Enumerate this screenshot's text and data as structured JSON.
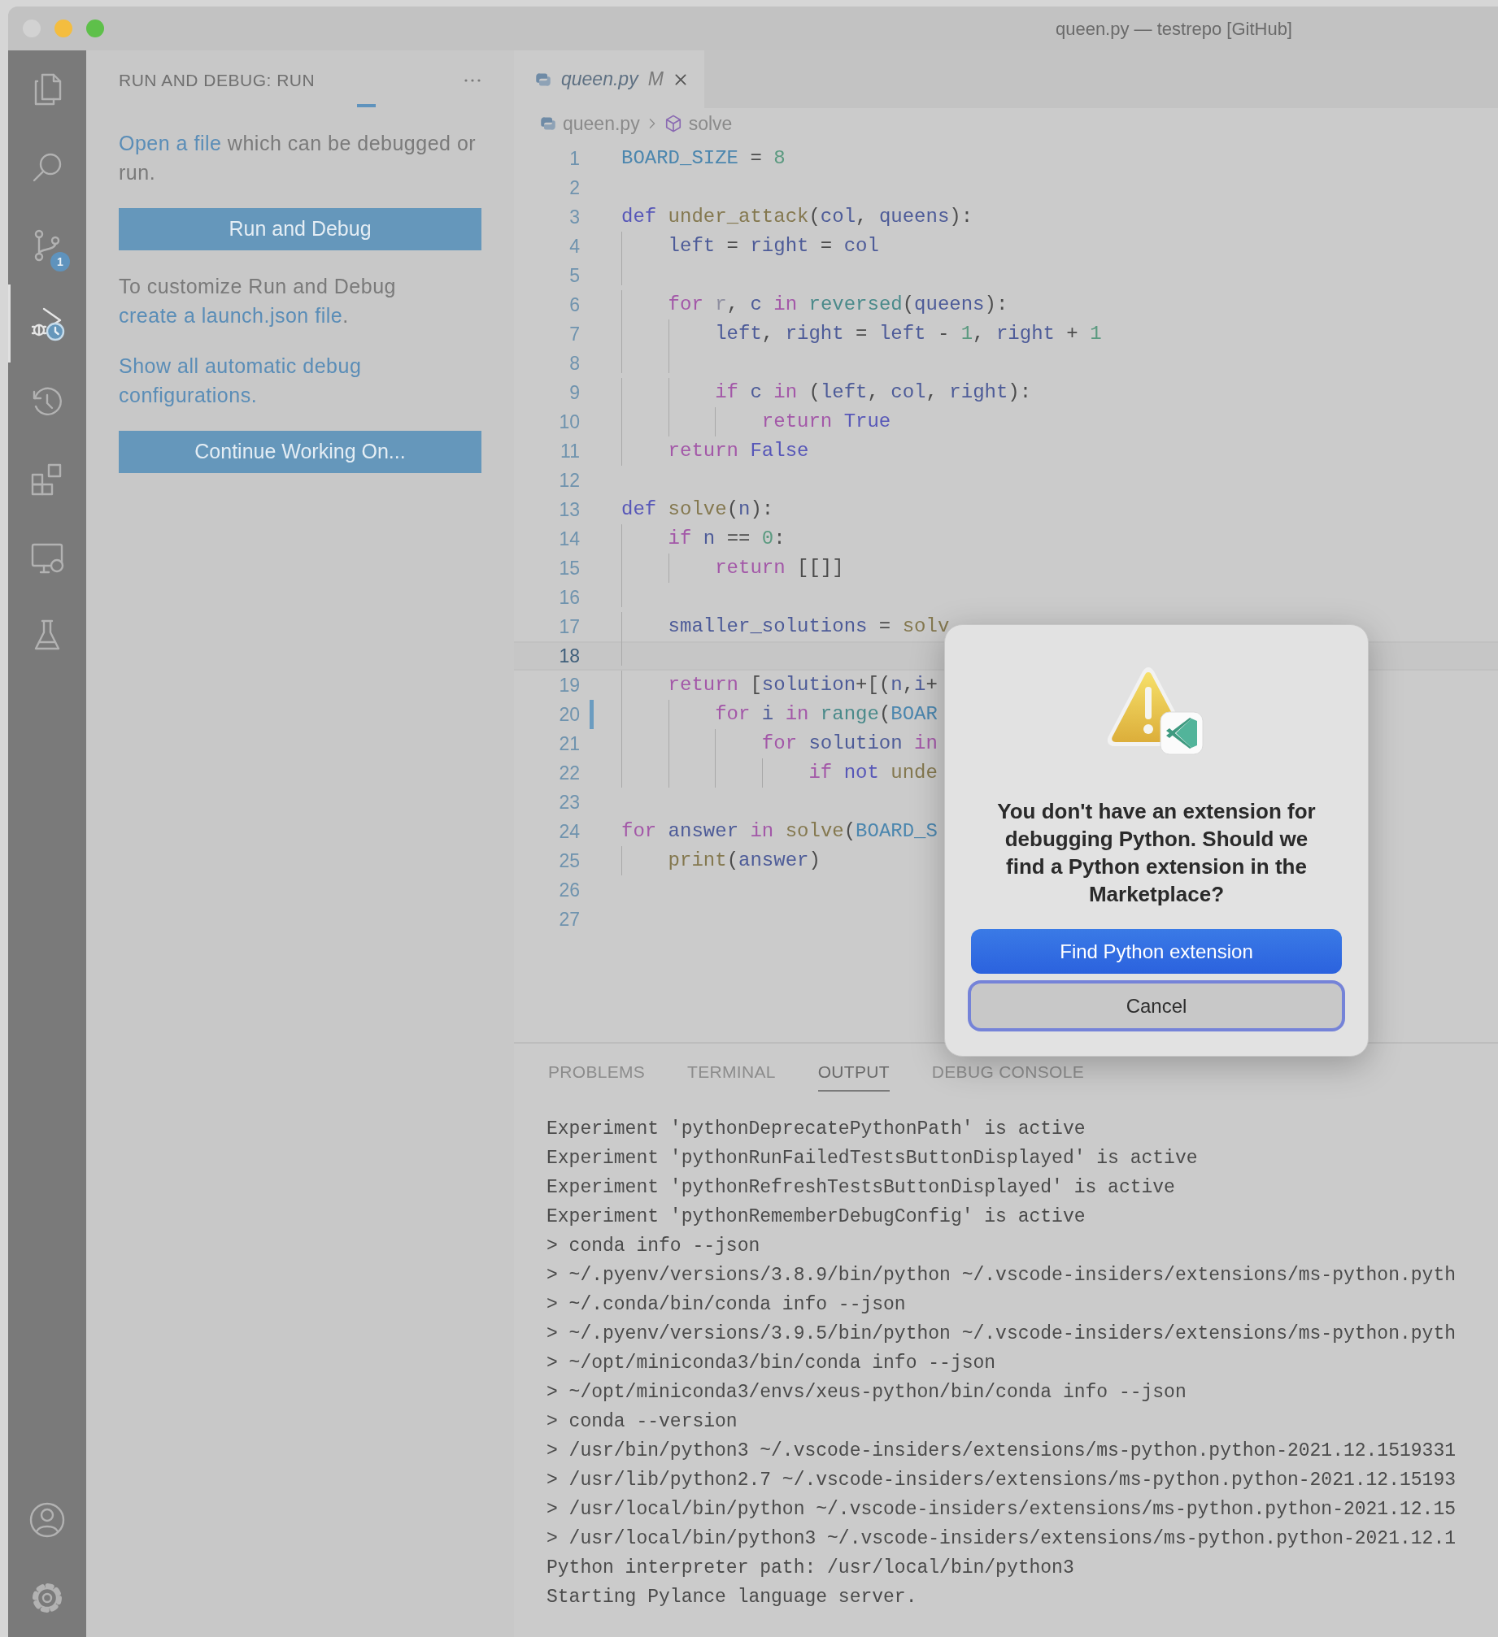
{
  "window": {
    "title": "queen.py — testrepo [GitHub]"
  },
  "activity_bar": {
    "items": [
      {
        "kind": "explorer",
        "selected": false
      },
      {
        "kind": "search",
        "selected": false
      },
      {
        "kind": "source-control",
        "selected": false,
        "badge": "1"
      },
      {
        "kind": "run-debug",
        "selected": true
      },
      {
        "kind": "timeline",
        "selected": false
      },
      {
        "kind": "extensions",
        "selected": false
      },
      {
        "kind": "remote",
        "selected": false
      },
      {
        "kind": "testing",
        "selected": false
      }
    ],
    "bottom_items": [
      {
        "kind": "account"
      },
      {
        "kind": "settings"
      }
    ]
  },
  "sidebar": {
    "title": "RUN AND DEBUG: RUN",
    "busy": true,
    "content": [
      {
        "kind": "paragraph",
        "parts": [
          {
            "text": "Open a file",
            "link": true
          },
          {
            "text": " which can be debugged or run.",
            "link": false
          }
        ]
      },
      {
        "kind": "button",
        "label": "Run and Debug"
      },
      {
        "kind": "paragraph",
        "parts": [
          {
            "text": "To customize Run and Debug ",
            "link": false
          },
          {
            "text": "create a launch.json file",
            "link": true
          },
          {
            "text": ".",
            "link": false
          }
        ]
      },
      {
        "kind": "paragraph",
        "parts": [
          {
            "text": "Show all automatic debug configurations.",
            "link": true
          }
        ]
      },
      {
        "kind": "button",
        "label": "Continue Working On..."
      }
    ]
  },
  "editor": {
    "tabs": [
      {
        "label": "queen.py",
        "badge": "M",
        "selected": true,
        "preview": true
      }
    ],
    "breadcrumb": [
      {
        "kind": "file",
        "text": "queen.py"
      },
      {
        "kind": "symbol",
        "text": "solve"
      }
    ],
    "lines": [
      {
        "number": "1",
        "current": false,
        "changed": false,
        "tokens": [
          {
            "kind": "const",
            "text": "BOARD_SIZE"
          },
          {
            "kind": "plain",
            "text": " = "
          },
          {
            "kind": "num",
            "text": "8"
          }
        ]
      },
      {
        "number": "2",
        "current": false,
        "changed": false
      },
      {
        "number": "3",
        "current": false,
        "changed": false,
        "tokens": [
          {
            "kind": "def",
            "text": "def"
          },
          {
            "kind": "fn",
            "text": " under_attack"
          },
          {
            "kind": "plain",
            "text": "("
          },
          {
            "kind": "var",
            "text": "col"
          },
          {
            "kind": "plain",
            "text": ", "
          },
          {
            "kind": "var",
            "text": "queens"
          },
          {
            "kind": "plain",
            "text": "):"
          }
        ]
      },
      {
        "number": "4",
        "current": false,
        "changed": false,
        "tokens": [
          {
            "kind": "var",
            "text": "    left"
          },
          {
            "kind": "plain",
            "text": " = "
          },
          {
            "kind": "var",
            "text": "right"
          },
          {
            "kind": "plain",
            "text": " = "
          },
          {
            "kind": "var",
            "text": "col"
          }
        ]
      },
      {
        "number": "5",
        "current": false,
        "changed": false
      },
      {
        "number": "6",
        "current": false,
        "changed": false,
        "tokens": [
          {
            "kind": "kw",
            "text": "    for"
          },
          {
            "kind": "unused",
            "text": " r"
          },
          {
            "kind": "plain",
            "text": ", "
          },
          {
            "kind": "var",
            "text": "c"
          },
          {
            "kind": "kw",
            "text": " in"
          },
          {
            "kind": "builtin",
            "text": " reversed"
          },
          {
            "kind": "plain",
            "text": "("
          },
          {
            "kind": "var",
            "text": "queens"
          },
          {
            "kind": "plain",
            "text": "):"
          }
        ]
      },
      {
        "number": "7",
        "current": false,
        "changed": false,
        "tokens": [
          {
            "kind": "var",
            "text": "        left"
          },
          {
            "kind": "plain",
            "text": ", "
          },
          {
            "kind": "var",
            "text": "right"
          },
          {
            "kind": "plain",
            "text": " = "
          },
          {
            "kind": "var",
            "text": "left"
          },
          {
            "kind": "plain",
            "text": " - "
          },
          {
            "kind": "num",
            "text": "1"
          },
          {
            "kind": "plain",
            "text": ", "
          },
          {
            "kind": "var",
            "text": "right"
          },
          {
            "kind": "plain",
            "text": " + "
          },
          {
            "kind": "num",
            "text": "1"
          }
        ]
      },
      {
        "number": "8",
        "current": false,
        "changed": false
      },
      {
        "number": "9",
        "current": false,
        "changed": false,
        "tokens": [
          {
            "kind": "kw",
            "text": "        if"
          },
          {
            "kind": "var",
            "text": " c"
          },
          {
            "kind": "kw",
            "text": " in"
          },
          {
            "kind": "plain",
            "text": " ("
          },
          {
            "kind": "var",
            "text": "left"
          },
          {
            "kind": "plain",
            "text": ", "
          },
          {
            "kind": "var",
            "text": "col"
          },
          {
            "kind": "plain",
            "text": ", "
          },
          {
            "kind": "var",
            "text": "right"
          },
          {
            "kind": "plain",
            "text": "):"
          }
        ]
      },
      {
        "number": "10",
        "current": false,
        "changed": false,
        "tokens": [
          {
            "kind": "kw",
            "text": "            return"
          },
          {
            "kind": "def",
            "text": " True"
          }
        ]
      },
      {
        "number": "11",
        "current": false,
        "changed": false,
        "tokens": [
          {
            "kind": "kw",
            "text": "    return"
          },
          {
            "kind": "def",
            "text": " False"
          }
        ]
      },
      {
        "number": "12",
        "current": false,
        "changed": false
      },
      {
        "number": "13",
        "current": false,
        "changed": false,
        "tokens": [
          {
            "kind": "def",
            "text": "def"
          },
          {
            "kind": "fn",
            "text": " solve"
          },
          {
            "kind": "plain",
            "text": "("
          },
          {
            "kind": "var",
            "text": "n"
          },
          {
            "kind": "plain",
            "text": "):"
          }
        ]
      },
      {
        "number": "14",
        "current": false,
        "changed": false,
        "tokens": [
          {
            "kind": "kw",
            "text": "    if"
          },
          {
            "kind": "var",
            "text": " n"
          },
          {
            "kind": "plain",
            "text": " == "
          },
          {
            "kind": "num",
            "text": "0"
          },
          {
            "kind": "plain",
            "text": ":"
          }
        ]
      },
      {
        "number": "15",
        "current": false,
        "changed": false,
        "tokens": [
          {
            "kind": "kw",
            "text": "        return"
          },
          {
            "kind": "plain",
            "text": " [[]]"
          }
        ]
      },
      {
        "number": "16",
        "current": false,
        "changed": false
      },
      {
        "number": "17",
        "current": false,
        "changed": false,
        "tokens": [
          {
            "kind": "var",
            "text": "    smaller_solutions"
          },
          {
            "kind": "plain",
            "text": " = "
          },
          {
            "kind": "fn",
            "text": "solv"
          }
        ]
      },
      {
        "number": "18",
        "current": true,
        "changed": false
      },
      {
        "number": "19",
        "current": false,
        "changed": false,
        "tokens": [
          {
            "kind": "kw",
            "text": "    return"
          },
          {
            "kind": "plain",
            "text": " ["
          },
          {
            "kind": "var",
            "text": "solution"
          },
          {
            "kind": "plain",
            "text": "+[("
          },
          {
            "kind": "var",
            "text": "n"
          },
          {
            "kind": "plain",
            "text": ","
          },
          {
            "kind": "var",
            "text": "i"
          },
          {
            "kind": "plain",
            "text": "+"
          }
        ]
      },
      {
        "number": "20",
        "current": false,
        "changed": true,
        "tokens": [
          {
            "kind": "kw",
            "text": "        for"
          },
          {
            "kind": "var",
            "text": " i"
          },
          {
            "kind": "kw",
            "text": " in"
          },
          {
            "kind": "builtin",
            "text": " range"
          },
          {
            "kind": "plain",
            "text": "("
          },
          {
            "kind": "const",
            "text": "BOAR"
          }
        ]
      },
      {
        "number": "21",
        "current": false,
        "changed": false,
        "tokens": [
          {
            "kind": "kw",
            "text": "            for"
          },
          {
            "kind": "var",
            "text": " solution"
          },
          {
            "kind": "kw",
            "text": " in"
          }
        ]
      },
      {
        "number": "22",
        "current": false,
        "changed": false,
        "tokens": [
          {
            "kind": "kw",
            "text": "                if"
          },
          {
            "kind": "def",
            "text": " not"
          },
          {
            "kind": "fn",
            "text": " unde"
          }
        ]
      },
      {
        "number": "23",
        "current": false,
        "changed": false
      },
      {
        "number": "24",
        "current": false,
        "changed": false,
        "tokens": [
          {
            "kind": "kw",
            "text": "for"
          },
          {
            "kind": "var",
            "text": " answer"
          },
          {
            "kind": "kw",
            "text": " in"
          },
          {
            "kind": "fn",
            "text": " solve"
          },
          {
            "kind": "plain",
            "text": "("
          },
          {
            "kind": "const",
            "text": "BOARD_S"
          }
        ]
      },
      {
        "number": "25",
        "current": false,
        "changed": false,
        "tokens": [
          {
            "kind": "fn",
            "text": "    print"
          },
          {
            "kind": "plain",
            "text": "("
          },
          {
            "kind": "var",
            "text": "answer"
          },
          {
            "kind": "plain",
            "text": ")"
          }
        ]
      },
      {
        "number": "26",
        "current": false,
        "changed": false
      },
      {
        "number": "27",
        "current": false,
        "changed": false
      }
    ]
  },
  "panel": {
    "tabs": [
      {
        "label": "PROBLEMS",
        "selected": false
      },
      {
        "label": "TERMINAL",
        "selected": false
      },
      {
        "label": "OUTPUT",
        "selected": true
      },
      {
        "label": "DEBUG CONSOLE",
        "selected": false
      }
    ],
    "output": [
      "Experiment 'pythonDeprecatePythonPath' is active",
      "Experiment 'pythonRunFailedTestsButtonDisplayed' is active",
      "Experiment 'pythonRefreshTestsButtonDisplayed' is active",
      "Experiment 'pythonRememberDebugConfig' is active",
      "> conda info --json",
      "> ~/.pyenv/versions/3.8.9/bin/python ~/.vscode-insiders/extensions/ms-python.pyth",
      "> ~/.conda/bin/conda info --json",
      "> ~/.pyenv/versions/3.9.5/bin/python ~/.vscode-insiders/extensions/ms-python.pyth",
      "> ~/opt/miniconda3/bin/conda info --json",
      "> ~/opt/miniconda3/envs/xeus-python/bin/conda info --json",
      "> conda --version",
      "> /usr/bin/python3 ~/.vscode-insiders/extensions/ms-python.python-2021.12.1519331",
      "> /usr/lib/python2.7 ~/.vscode-insiders/extensions/ms-python.python-2021.12.15193",
      "> /usr/local/bin/python ~/.vscode-insiders/extensions/ms-python.python-2021.12.15",
      "> /usr/local/bin/python3 ~/.vscode-insiders/extensions/ms-python.python-2021.12.1",
      "Python interpreter path: /usr/local/bin/python3",
      "Starting Pylance language server."
    ]
  },
  "dialog": {
    "message": "You don't have an extension for debugging Python. Should we find a Python extension in the Marketplace?",
    "buttons": [
      {
        "label": "Find Python extension",
        "kind": "primary",
        "focused": false
      },
      {
        "label": "Cancel",
        "kind": "default",
        "focused": true
      }
    ]
  }
}
